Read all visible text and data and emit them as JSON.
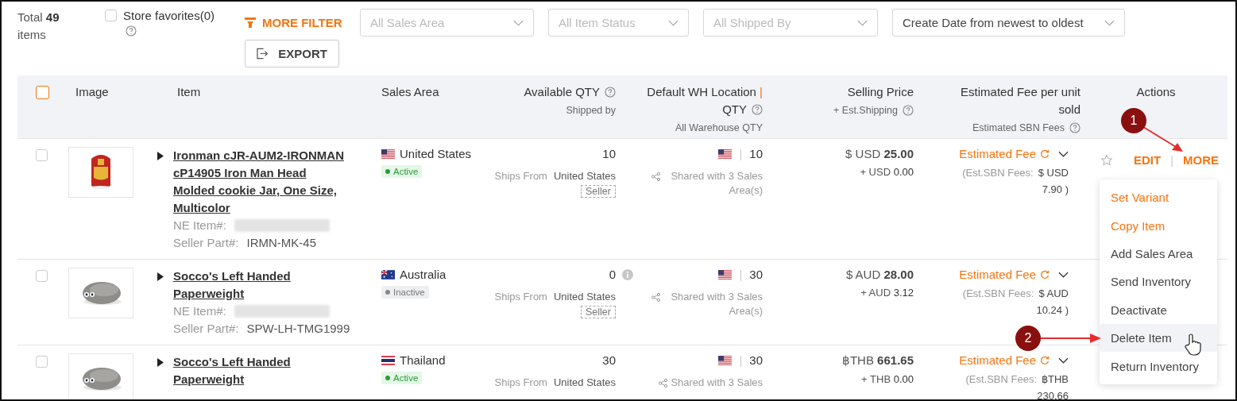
{
  "toolbar": {
    "total_label": "Total",
    "total_count": "49",
    "total_unit": "items",
    "favorites": {
      "label": "Store favorites(0)",
      "checked": false
    },
    "more_filter": "MORE FILTER",
    "export": "EXPORT",
    "selects": [
      {
        "placeholder": "All Sales Area"
      },
      {
        "placeholder": "All Item Status"
      },
      {
        "placeholder": "All Shipped By"
      },
      {
        "value": "Create Date from newest to oldest"
      }
    ]
  },
  "table": {
    "select_all": {
      "checked": false
    },
    "columns": [
      {
        "label": "Image"
      },
      {
        "label": "Item"
      },
      {
        "label": "Sales Area"
      },
      {
        "label": "Available QTY",
        "help": true,
        "sub": "Shipped by"
      },
      {
        "label": "Default WH Location",
        "separator": "|",
        "label2": "QTY",
        "help": true,
        "sub": "All Warehouse QTY"
      },
      {
        "label": "Selling Price",
        "sub": "+ Est.Shipping",
        "sub_help": true
      },
      {
        "label": "Estimated Fee per unit sold",
        "sub": "Estimated SBN Fees",
        "sub_help": true
      },
      {
        "label": "Actions"
      }
    ],
    "rows": [
      {
        "checked": false,
        "title": "Ironman cJR-AUM2-IRONMAN cP14905 Iron Man Head Molded cookie Jar, One Size, Multicolor",
        "ne_label": "NE Item#:",
        "seller_part_label": "Seller Part#:",
        "seller_part": "IRMN-MK-45",
        "flag": {
          "kind": "us"
        },
        "sales_area": "United States",
        "status": {
          "label": "Active",
          "active": true
        },
        "qty": "10",
        "ships_label": "Ships From",
        "ships_from": "United States",
        "shipped_by": "Seller",
        "wh_flag": {
          "kind": "us"
        },
        "wh_sep": "|",
        "wh_qty": "10",
        "shared": "Shared with 3 Sales Area(s)",
        "price_currency": "$ USD",
        "price": "25.00",
        "ship_currency": "+ USD",
        "ship": "0.00",
        "fee_label": "Estimated Fee",
        "fee_note": "(Est.SBN Fees:",
        "fee_currency": "$ USD",
        "fee_amount": "7.90 )",
        "actions": {
          "edit": "EDIT",
          "sep": "|",
          "more": "MORE",
          "favorite": false
        }
      },
      {
        "checked": false,
        "title": "Socco's Left Handed Paperweight",
        "ne_label": "NE Item#:",
        "seller_part_label": "Seller Part#:",
        "seller_part": "SPW-LH-TMG1999",
        "flag": {
          "kind": "au"
        },
        "sales_area": "Australia",
        "status": {
          "label": "Inactive",
          "active": false
        },
        "qty": "0",
        "qty_info": true,
        "ships_label": "Ships From",
        "ships_from": "United States",
        "shipped_by": "Seller",
        "wh_flag": {
          "kind": "us"
        },
        "wh_sep": "|",
        "wh_qty": "30",
        "shared": "Shared with 3 Sales Area(s)",
        "price_currency": "$ AUD",
        "price": "28.00",
        "ship_currency": "+ AUD",
        "ship": "3.12",
        "fee_label": "Estimated Fee",
        "fee_note": "(Est.SBN Fees:",
        "fee_currency": "$ AUD",
        "fee_amount": "10.24 )"
      },
      {
        "checked": false,
        "title": "Socco's Left Handed Paperweight",
        "flag": {
          "kind": "th"
        },
        "sales_area": "Thailand",
        "status": {
          "label": "Active",
          "active": true
        },
        "qty": "30",
        "ships_label": "Ships From",
        "ships_from": "United States",
        "wh_flag": {
          "kind": "us"
        },
        "wh_sep": "|",
        "wh_qty": "30",
        "shared": "Shared with 3 Sales",
        "price_currency": "฿THB",
        "price": "661.65",
        "ship_currency": "+ THB",
        "ship": "0.00",
        "fee_label": "Estimated Fee",
        "fee_note": "(Est.SBN Fees:",
        "fee_currency": "฿THB",
        "fee_amount": "230.66"
      }
    ]
  },
  "more_menu": [
    {
      "label": "Set Variant",
      "kind": "accent",
      "selected": false
    },
    {
      "label": "Copy Item",
      "kind": "accent",
      "selected": false
    },
    {
      "label": "Add Sales Area",
      "kind": "plain",
      "selected": false
    },
    {
      "label": "Send Inventory",
      "kind": "plain",
      "selected": false
    },
    {
      "label": "Deactivate",
      "kind": "plain",
      "selected": false
    },
    {
      "label": "Delete Item",
      "kind": "plain",
      "selected": true
    },
    {
      "label": "Return Inventory",
      "kind": "plain",
      "selected": false
    }
  ],
  "callouts": [
    {
      "number": "1"
    },
    {
      "number": "2"
    }
  ]
}
